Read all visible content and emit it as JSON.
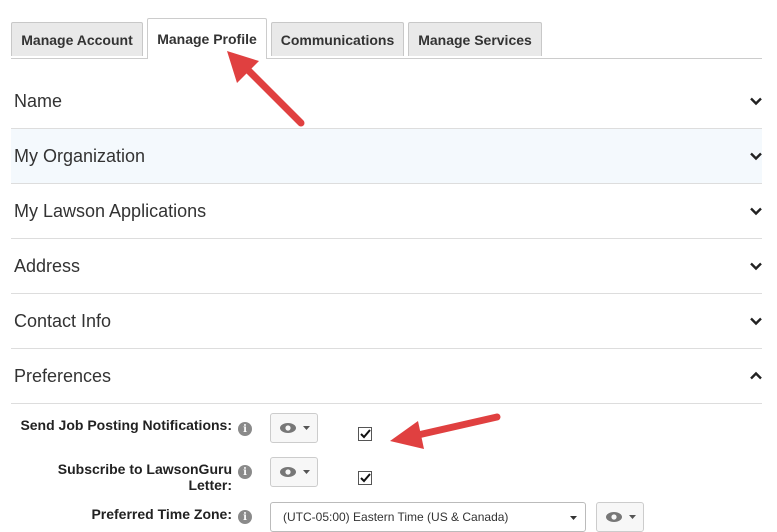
{
  "tabs": [
    {
      "label": "Manage Account"
    },
    {
      "label": "Manage Profile"
    },
    {
      "label": "Communications"
    },
    {
      "label": "Manage Services"
    }
  ],
  "active_tab": "Manage Profile",
  "sections": [
    {
      "label": "Name",
      "expanded": false
    },
    {
      "label": "My Organization",
      "expanded": false
    },
    {
      "label": "My Lawson Applications",
      "expanded": false
    },
    {
      "label": "Address",
      "expanded": false
    },
    {
      "label": "Contact Info",
      "expanded": false
    },
    {
      "label": "Preferences",
      "expanded": true
    }
  ],
  "preferences": {
    "job_posting": {
      "label": "Send Job Posting Notifications:",
      "checked": true
    },
    "lawsonguru": {
      "label_line1": "Subscribe to LawsonGuru",
      "label_line2": "Letter:",
      "checked": true
    },
    "timezone": {
      "label": "Preferred Time Zone:",
      "value": "(UTC-05:00) Eastern Time (US & Canada)"
    }
  },
  "annotation_color": "#e04040"
}
